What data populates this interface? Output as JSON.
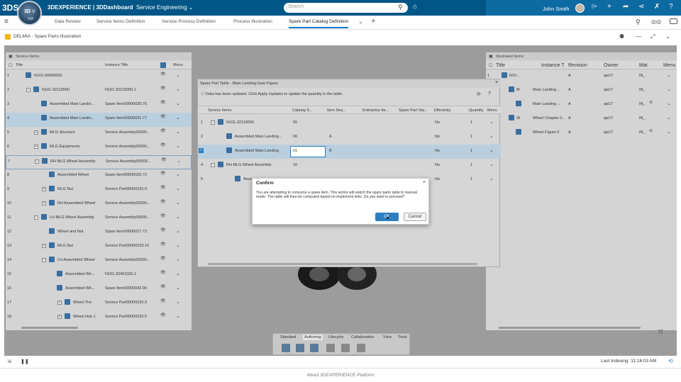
{
  "topbar": {
    "logo": "3DS",
    "compass_3d": "3D",
    "compass_v": "V",
    "compass_vr": "V,R",
    "brand": "3DEXPERIENCE | 3DDashboard",
    "dashboard": "Service Engineering",
    "search_placeholder": "Search",
    "username": "John Smith"
  },
  "tabs": [
    "Data Review",
    "Service Items Definition",
    "Service Process Definition",
    "Process Illustration",
    "Spare Part Catalog Definition"
  ],
  "app_title": "DELMIA - Spare Parts Illustration",
  "left_panel": {
    "title": "Service Items",
    "cols": [
      "Title",
      "Instance Title",
      "Menu"
    ],
    "rows": [
      {
        "n": "1",
        "title": "N101-00000003",
        "inst": ""
      },
      {
        "n": "2",
        "title": "N101-32110000",
        "inst": "N101-32110000.1"
      },
      {
        "n": "3",
        "title": "Assembled Main Landin...",
        "inst": "Spare Item00000030.76"
      },
      {
        "n": "4",
        "title": "Assembled Main Landin...",
        "inst": "Spare Item00000031.77"
      },
      {
        "n": "5",
        "title": "MLG Structure",
        "inst": "Service Assembly00000..."
      },
      {
        "n": "6",
        "title": "MLG Equipments",
        "inst": "Service Assembly00000..."
      },
      {
        "n": "7",
        "title": "RH MLG Wheel Assembly",
        "inst": "Service Assembly00000..."
      },
      {
        "n": "8",
        "title": "Assembled Wheel",
        "inst": "Spare Item00000026.72"
      },
      {
        "n": "9",
        "title": "MLG Nut",
        "inst": "Service Part00000192.9"
      },
      {
        "n": "10",
        "title": "RH Assembled Wheel",
        "inst": "Service Assembly00000..."
      },
      {
        "n": "11",
        "title": "LH MLG Wheel Assembly",
        "inst": "Service Assembly00000..."
      },
      {
        "n": "12",
        "title": "Wheel and Nut",
        "inst": "Spare Item00000027.73"
      },
      {
        "n": "13",
        "title": "MLG Nut",
        "inst": "Service Part00000193.10"
      },
      {
        "n": "14",
        "title": "LH Assembled Wheel",
        "inst": "Service Assembly00000..."
      },
      {
        "n": "15",
        "title": "Assembled Wh...",
        "inst": "N101-32401000.1"
      },
      {
        "n": "16",
        "title": "Assembled Wh...",
        "inst": "Spare Item00000042.90"
      },
      {
        "n": "17",
        "title": "Wheel Tire",
        "inst": "Service Part00000225.3"
      },
      {
        "n": "18",
        "title": "Wheel Hub 1",
        "inst": "Service Part00000226.5"
      }
    ]
  },
  "right_panel": {
    "title": "Illustrated Items",
    "cols": [
      "Title",
      "Instance T",
      "Revision",
      "Owner",
      "Mat",
      "Menu"
    ],
    "rows": [
      {
        "n": "1",
        "title": "N10...",
        "inst": "",
        "rev": "A",
        "owner": "api17",
        "mat": "IN_"
      },
      {
        "n": "2",
        "title": "M",
        "inst": "Main Landing ...",
        "rev": "A",
        "owner": "api17",
        "mat": "IN_"
      },
      {
        "n": "3",
        "title": "",
        "inst": "Main Landing ...",
        "rev": "A",
        "owner": "api17",
        "mat": "IN_"
      },
      {
        "n": "4",
        "title": "W",
        "inst": "Wheel Chapter 0...",
        "rev": "A",
        "owner": "api17",
        "mat": "IN_"
      },
      {
        "n": "5",
        "title": "",
        "inst": "Wheel Figure 0",
        "rev": "A",
        "owner": "api17",
        "mat": "IN_"
      }
    ]
  },
  "spare_table": {
    "title": "Spare Part Table - Main Landing Gear Figure",
    "info": "Data has been updated. Click Apply Updates to update the quantity in the table.",
    "cols": [
      "Service Items",
      "Catalog S...",
      "Item Seq...",
      "Enterprise Ite...",
      "Spare Part Sta...",
      "Effectivity",
      "Quantity",
      "Menu"
    ],
    "rows": [
      {
        "n": "1",
        "item": "N101-32110000",
        "cat": "00",
        "seq": "",
        "eff": "No",
        "qty": "1"
      },
      {
        "n": "2",
        "item": "Assembled Main Landing...",
        "cat": "00",
        "seq": "A",
        "eff": "No",
        "qty": "1"
      },
      {
        "n": "3",
        "item": "Assembled Main Landing",
        "cat": "01",
        "seq": "B",
        "eff": "No",
        "qty": "1"
      },
      {
        "n": "4",
        "item": "RH MLG Wheel Assembly",
        "cat": "10",
        "seq": "",
        "eff": "No",
        "qty": "1"
      },
      {
        "n": "5",
        "item": "Asse...",
        "cat": "",
        "seq": "",
        "eff": "No",
        "qty": "1"
      }
    ]
  },
  "confirm": {
    "title": "Confirm",
    "message": "You are attempting to consume a spare item. This action will switch the spare parts table to manual mode. The table will then be computed based on implement links. Do you want to proceed?",
    "ok": "OK",
    "cancel": "Cancel"
  },
  "toolbar_tabs": [
    "Standard",
    "Authoring",
    "Lifecycle",
    "Collaboration",
    "View",
    "Tools"
  ],
  "status": {
    "indexing": "Last Indexing :11:16:03 AM"
  },
  "footer": "About 3DEXPERIENCE Platform"
}
